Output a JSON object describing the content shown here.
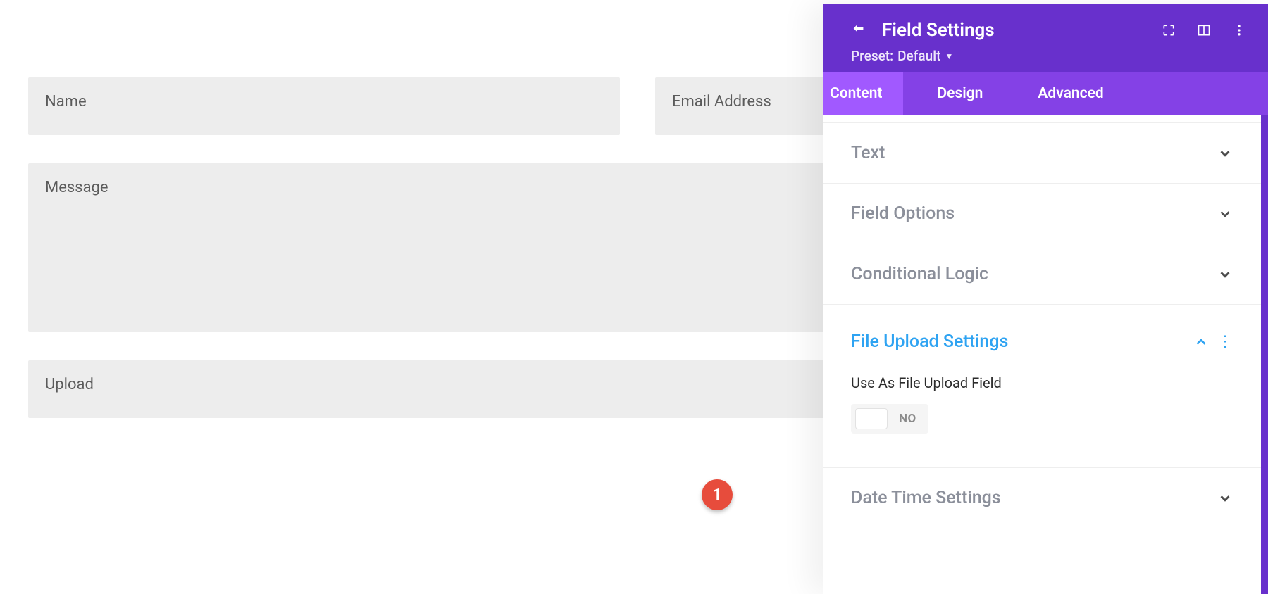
{
  "form": {
    "name_label": "Name",
    "email_label": "Email Address",
    "message_label": "Message",
    "upload_label": "Upload"
  },
  "panel": {
    "title": "Field Settings",
    "preset_prefix": "Preset:",
    "preset_value": "Default",
    "tabs": {
      "content": "Content",
      "design": "Design",
      "advanced": "Advanced"
    },
    "accordion": {
      "text": "Text",
      "field_options": "Field Options",
      "conditional_logic": "Conditional Logic",
      "file_upload": "File Upload Settings",
      "date_time": "Date Time Settings"
    },
    "file_upload_body": {
      "label": "Use As File Upload Field",
      "toggle_state": "NO"
    }
  },
  "annotation": {
    "badge_1": "1"
  }
}
